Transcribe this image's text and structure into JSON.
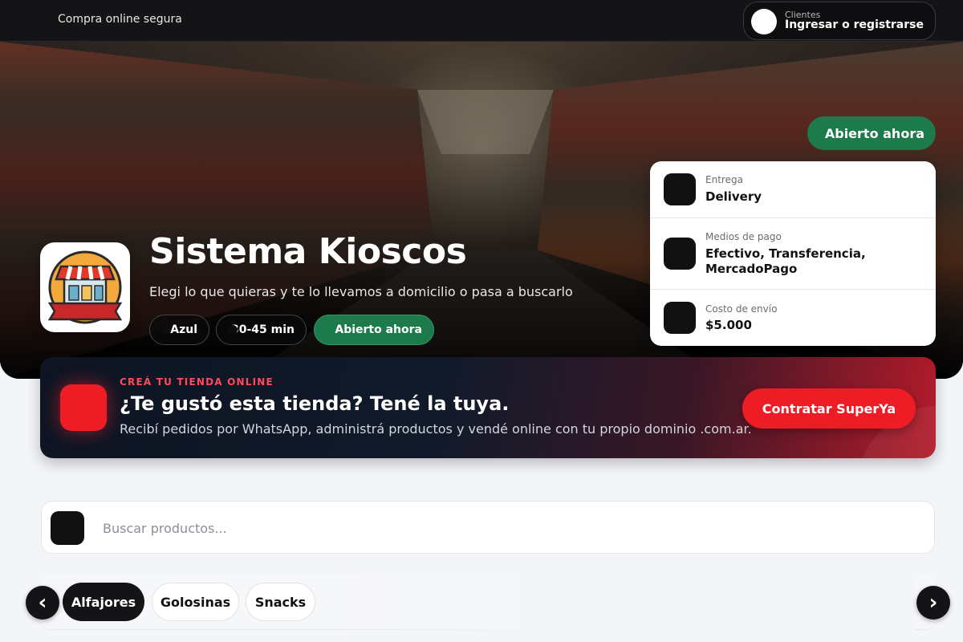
{
  "topbar": {
    "secure_text": "Compra online segura",
    "client": {
      "label": "Clientes",
      "action": "Ingresar o registrarse"
    }
  },
  "hero": {
    "title": "Sistema Kioscos",
    "subtitle": "Elegi lo que quieras y te lo llevamos a domicilio o pasa a buscarlo",
    "chips": [
      {
        "label": "Azul"
      },
      {
        "label": "30-45 min"
      },
      {
        "label": "Abierto ahora"
      }
    ],
    "status_badge": "Abierto ahora",
    "info": [
      {
        "label": "Entrega",
        "value": "Delivery",
        "icon": "truck-icon"
      },
      {
        "label": "Medios de pago",
        "value": "Efectivo, Transferencia, MercadoPago",
        "icon": "wallet-icon"
      },
      {
        "label": "Costo de envío",
        "value": "$5.000",
        "icon": "price-tag-icon"
      }
    ]
  },
  "promo": {
    "eyebrow": "CREÁ TU TIENDA ONLINE",
    "title": "¿Te gustó esta tienda? Tené la tuya.",
    "description": "Recibí pedidos por WhatsApp, administrá productos y vendé online con tu propio dominio .com.ar.",
    "button": "Contratar SuperYa"
  },
  "search": {
    "placeholder": "Buscar productos...",
    "value": ""
  },
  "categories": {
    "items": [
      {
        "label": "Alfajores",
        "active": true
      },
      {
        "label": "Golosinas",
        "active": false
      },
      {
        "label": "Snacks",
        "active": false
      }
    ],
    "prev_arrow": "‹",
    "next_arrow": "›"
  },
  "colors": {
    "topbar_bg": "#141416",
    "accent_red": "#ee1c25",
    "open_green": "#1c7a4b",
    "promo_dark": "#0e1523"
  }
}
